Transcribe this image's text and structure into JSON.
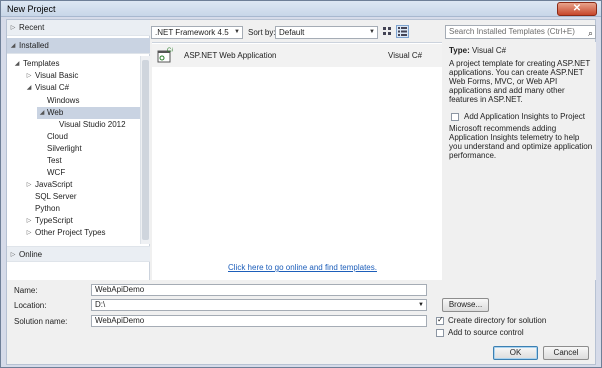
{
  "window": {
    "title": "New Project",
    "close_glyph": "✕"
  },
  "nav": {
    "recent": "Recent",
    "installed": "Installed",
    "tree": [
      {
        "label": "Templates",
        "arrow": "◢"
      },
      {
        "label": "Visual Basic",
        "arrow": "▷"
      },
      {
        "label": "Visual C#",
        "arrow": "◢"
      },
      {
        "label": "Windows",
        "arrow": ""
      },
      {
        "label": "Web",
        "arrow": "◢"
      },
      {
        "label": "Visual Studio 2012",
        "arrow": ""
      },
      {
        "label": "Cloud",
        "arrow": ""
      },
      {
        "label": "Silverlight",
        "arrow": ""
      },
      {
        "label": "Test",
        "arrow": ""
      },
      {
        "label": "WCF",
        "arrow": ""
      },
      {
        "label": "JavaScript",
        "arrow": "▷"
      },
      {
        "label": "SQL Server",
        "arrow": ""
      },
      {
        "label": "Python",
        "arrow": ""
      },
      {
        "label": "TypeScript",
        "arrow": "▷"
      },
      {
        "label": "Other Project Types",
        "arrow": "▷"
      }
    ],
    "online": "Online",
    "selected": "Web"
  },
  "toolbar": {
    "framework": ".NET Framework 4.5",
    "sort_label": "Sort by:",
    "sort_value": "Default",
    "search_placeholder": "Search Installed Templates (Ctrl+E)"
  },
  "templates": {
    "items": [
      {
        "name": "ASP.NET Web Application",
        "language": "Visual C#"
      }
    ],
    "online_link": "Click here to go online and find templates."
  },
  "details": {
    "type_label": "Type:",
    "type_value": "Visual C#",
    "description": "A project template for creating ASP.NET applications. You can create ASP.NET Web Forms, MVC,  or Web API applications and add many other features in ASP.NET.",
    "insights_label": "Add Application Insights to Project",
    "insights_checked": false,
    "insights_description": "Microsoft recommends adding Application Insights telemetry to help you understand and optimize application performance."
  },
  "form": {
    "name_label": "Name:",
    "name_value": "WebApiDemo",
    "location_label": "Location:",
    "location_value": "D:\\",
    "solution_label": "Solution name:",
    "solution_value": "WebApiDemo",
    "browse_label": "Browse...",
    "create_dir_label": "Create directory for solution",
    "create_dir_checked": true,
    "source_control_label": "Add to source control",
    "source_control_checked": false
  },
  "buttons": {
    "ok": "OK",
    "cancel": "Cancel"
  },
  "colors": {
    "link": "#1d5eba",
    "selection": "#c9d3e2",
    "window_frame": "#d6dbe9"
  }
}
